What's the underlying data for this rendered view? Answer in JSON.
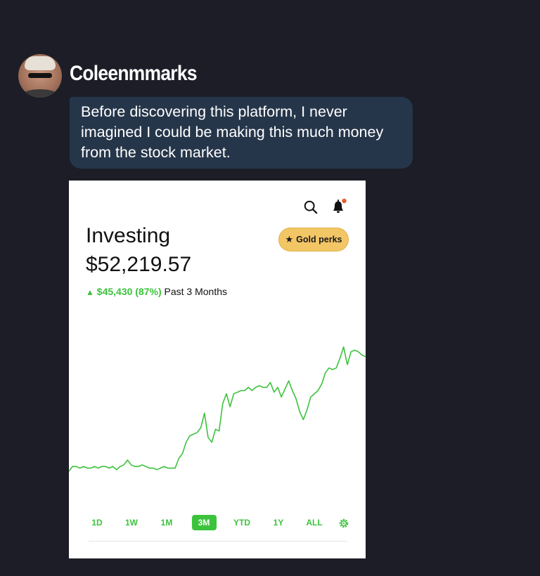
{
  "message": {
    "username": "Coleenmmarks",
    "text": "Before discovering this platform, I never imagined I could be making this much money from the stock market."
  },
  "screenshot": {
    "title": "Investing",
    "value": "$52,219.57",
    "change_amount": "$45,430 (87%)",
    "change_period": "Past 3 Months",
    "gold_perks_label": "Gold perks",
    "ranges": [
      "1D",
      "1W",
      "1M",
      "3M",
      "YTD",
      "1Y",
      "ALL"
    ],
    "active_range": "3M",
    "accent_color": "#3cc33c",
    "gold_color": "#f3c665",
    "chart_data": {
      "type": "line",
      "title": "",
      "xlabel": "",
      "ylabel": "",
      "grid": false,
      "ylim": [
        0,
        100
      ],
      "values": [
        20,
        23,
        23,
        22,
        23,
        22,
        22,
        23,
        22,
        23,
        23,
        22,
        23,
        21,
        23,
        24,
        27,
        24,
        23,
        23,
        24,
        23,
        22,
        22,
        21,
        22,
        23,
        22,
        22,
        22,
        28,
        31,
        38,
        42,
        43,
        44,
        47,
        56,
        41,
        38,
        46,
        45,
        62,
        68,
        60,
        68,
        69,
        70,
        70,
        72,
        70,
        72,
        73,
        72,
        72,
        75,
        69,
        72,
        66,
        71,
        76,
        70,
        65,
        57,
        52,
        58,
        66,
        68,
        70,
        74,
        81,
        84,
        83,
        84,
        90,
        97,
        86,
        94,
        95,
        94,
        92,
        91
      ]
    }
  }
}
